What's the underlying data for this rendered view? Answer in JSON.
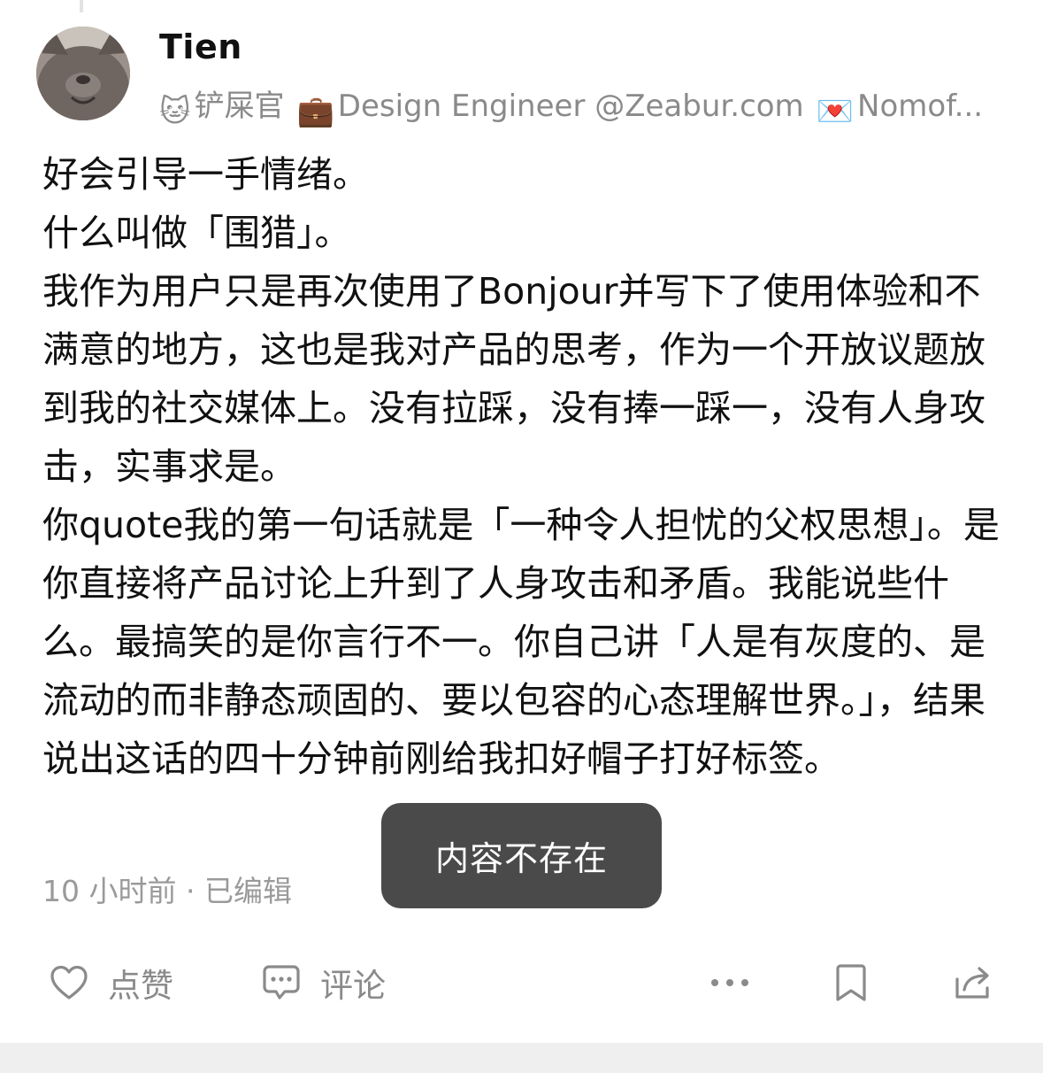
{
  "author": {
    "name": "Tien",
    "bio": {
      "role_emoji": "🐱",
      "role": "铲屎官",
      "job_emoji": "💼",
      "job": "Design Engineer @Zeabur.com",
      "mail_emoji": "💌",
      "contact": "Nomof..."
    }
  },
  "post": {
    "paragraphs": [
      "好会引导一手情绪。",
      "什么叫做「围猎」。",
      "我作为用户只是再次使用了Bonjour并写下了使用体验和不满意的地方，这也是我对产品的思考，作为一个开放议题放到我的社交媒体上。没有拉踩，没有捧一踩一，没有人身攻击，实事求是。",
      "你quote我的第一句话就是「一种令人担忧的父权思想」。是你直接将产品讨论上升到了人身攻击和矛盾。我能说些什么。最搞笑的是你言行不一。你自己讲「人是有灰度的、是流动的而非静态顽固的、要以包容的心态理解世界。」，结果说出这话的四十分钟前刚给我扣好帽子打好标签。"
    ],
    "meta": "10 小时前 · 已编辑"
  },
  "toast": {
    "message": "内容不存在"
  },
  "actions": {
    "like_label": "点赞",
    "comment_label": "评论"
  },
  "colors": {
    "text": "#111111",
    "muted": "#8a8a8a",
    "toast_bg": "#4a4a4a"
  }
}
